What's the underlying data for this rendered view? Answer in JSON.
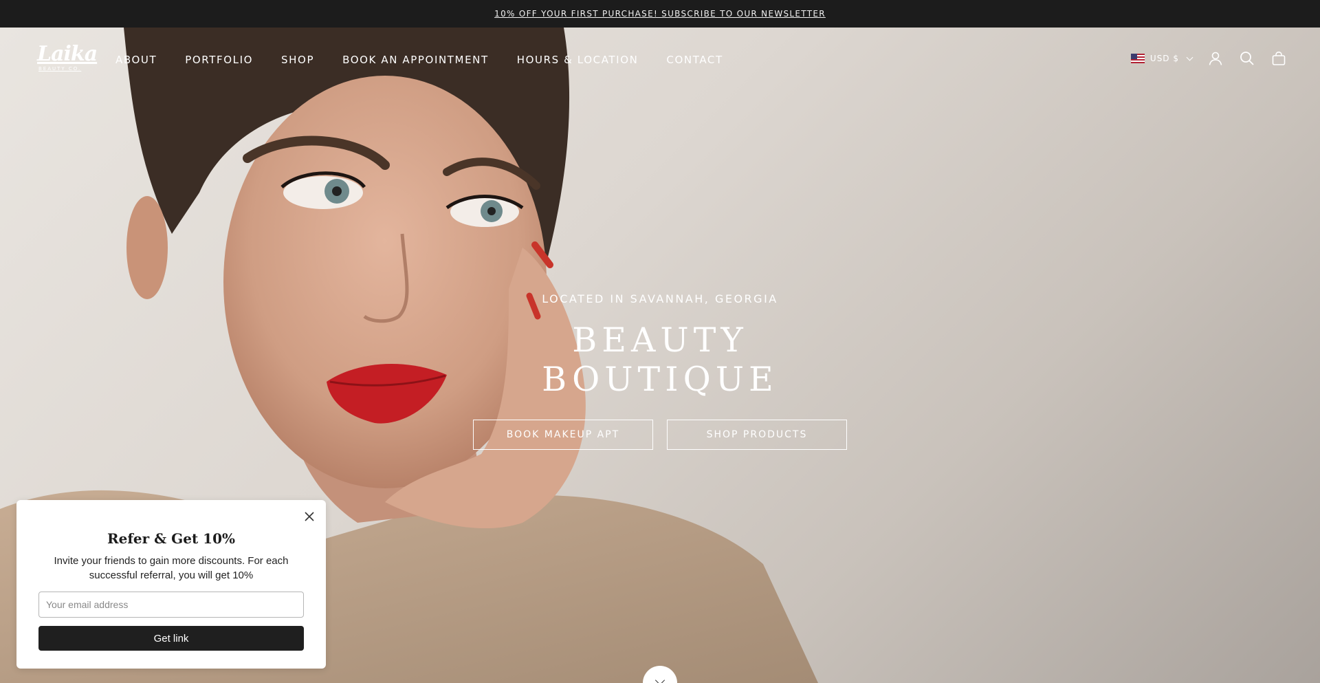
{
  "announcement": {
    "text": "10% OFF YOUR FIRST PURCHASE! SUBSCRIBE TO OUR NEWSLETTER"
  },
  "brand": {
    "logo_script": "Laika",
    "logo_sub": "BEAUTY CO."
  },
  "nav": {
    "items": [
      {
        "label": "ABOUT"
      },
      {
        "label": "PORTFOLIO"
      },
      {
        "label": "SHOP"
      },
      {
        "label": "BOOK AN APPOINTMENT"
      },
      {
        "label": "HOURS & LOCATION"
      },
      {
        "label": "CONTACT"
      }
    ]
  },
  "header_tools": {
    "currency": "USD $",
    "icons": [
      "account-icon",
      "search-icon",
      "bag-icon"
    ]
  },
  "hero": {
    "eyebrow": "LOCATED IN SAVANNAH, GEORGIA",
    "headline": "BEAUTY BOUTIQUE",
    "cta_primary": "BOOK MAKEUP APT",
    "cta_secondary": "SHOP PRODUCTS"
  },
  "referral_popup": {
    "title": "Refer & Get 10%",
    "body": "Invite your friends to gain more discounts. For each successful referral, you will get 10%",
    "email_placeholder": "Your email address",
    "submit_label": "Get link"
  }
}
